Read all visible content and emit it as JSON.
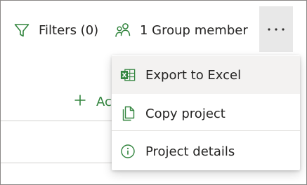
{
  "toolbar": {
    "filters_label": "Filters (0)",
    "members_label": "1 Group member",
    "more_label": "..."
  },
  "main": {
    "add_label": "Ac"
  },
  "menu": {
    "items": [
      {
        "label": "Export to Excel",
        "icon": "excel-icon"
      },
      {
        "label": "Copy project",
        "icon": "copy-icon"
      },
      {
        "label": "Project details",
        "icon": "info-icon"
      }
    ]
  },
  "colors": {
    "accent_green": "#33853f",
    "hover_bg": "#f3f2f1",
    "more_button_bg": "#e8e8e8",
    "text": "#252423"
  }
}
